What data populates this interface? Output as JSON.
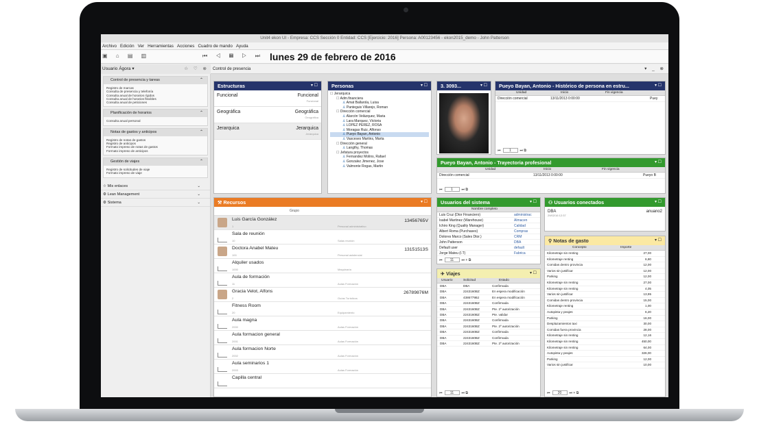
{
  "app": {
    "title": "Unit4 ekon UI - Empresa: CCS Sección 0 Entidad: CCS [Ejercicio: 2016] Persona: A00123456 - ekon2015_demo - John Patterson",
    "menu": [
      "Archivo",
      "Edición",
      "Ver",
      "Herramientas",
      "Acciones",
      "Cuadro de mando",
      "Ayuda"
    ],
    "date": "lunes 29 de febrero de 2016",
    "user": "Usuario Ágora",
    "main_title": "Control de presencia"
  },
  "sidebar": {
    "groups": [
      {
        "title": "Control de presencia y tareas",
        "items": [
          "Registro de marcas",
          "Consulta de presencia y telefonía",
          "Consulta anual de horarios rígidos",
          "Consulta anual de horarios flexibles",
          "Consulta anual de peticiones"
        ]
      },
      {
        "title": "Planificación de horarios",
        "items": [
          "Consulta anual personal"
        ]
      },
      {
        "title": "Notas de gastos y anticipos",
        "items": [
          "Registro de notas de gastos",
          "Registro de anticipos",
          "Formato impreso de notas de gastos",
          "Formato impreso de anticipos"
        ]
      },
      {
        "title": "Gestión de viajes",
        "items": [
          "Registro de solicitudes de viaje",
          "Formato impreso de viaje"
        ]
      }
    ],
    "sections": [
      "Mis enlaces",
      "Lean Management",
      "Sistema"
    ]
  },
  "estructuras": {
    "title": "Estructuras",
    "rows": [
      {
        "name": "Funcional",
        "right": "Funcional",
        "sub": "Funcional"
      },
      {
        "name": "Geográfica",
        "right": "Geográfica",
        "sub": "Geográfica"
      },
      {
        "name": "Jerarquica",
        "right": "Jerarquica",
        "sub": "Jerárquica"
      }
    ]
  },
  "personas": {
    "title": "Personas",
    "tree": [
      {
        "t": "Jerarquica",
        "lvl": 0,
        "k": "folder"
      },
      {
        "t": "Adm.financiera",
        "lvl": 1,
        "k": "folder"
      },
      {
        "t": "Amat Ballarola, Luisa",
        "lvl": 2,
        "k": "person"
      },
      {
        "t": "Panteguis Villarejo, Roman",
        "lvl": 2,
        "k": "person"
      },
      {
        "t": "Dirección comercial",
        "lvl": 1,
        "k": "folder"
      },
      {
        "t": "Alarcón Velázquez, Maria",
        "lvl": 2,
        "k": "person"
      },
      {
        "t": "Lara Marquez, Victoria",
        "lvl": 2,
        "k": "person"
      },
      {
        "t": "LOPEZ PEREZ, ROSA",
        "lvl": 2,
        "k": "person"
      },
      {
        "t": "Moragas Ruiz, Alfonso",
        "lvl": 2,
        "k": "person"
      },
      {
        "t": "Pueyo Bayan, Antonio",
        "lvl": 2,
        "k": "person",
        "sel": true
      },
      {
        "t": "Vasceses Martins, Marta",
        "lvl": 2,
        "k": "person"
      },
      {
        "t": "Dirección general",
        "lvl": 1,
        "k": "folder"
      },
      {
        "t": "Langthy, Thomas",
        "lvl": 2,
        "k": "person"
      },
      {
        "t": "Jefatura proyectos",
        "lvl": 1,
        "k": "folder"
      },
      {
        "t": "Fernandez Molins, Rafael",
        "lvl": 2,
        "k": "person"
      },
      {
        "t": "Gonzalez Jimenez, Jose",
        "lvl": 2,
        "k": "person"
      },
      {
        "t": "Valmonte Rogas, Martin",
        "lvl": 2,
        "k": "person"
      }
    ]
  },
  "photo_panel": {
    "title": "3. 3093..."
  },
  "historico": {
    "title": "Pueyo Bayan, Antonio - Histórico de persona en estru...",
    "headers": [
      "Unidad",
      "Inicio",
      "Fin vigencia"
    ],
    "rows": [
      [
        "Dirección comercial",
        "13/11/2013 0:00:00",
        "Puey"
      ]
    ],
    "page": "1"
  },
  "trayectoria": {
    "title": "Pueyo Bayan, Antonio - Trayectoria profesional",
    "headers": [
      "Unidad",
      "Inicio",
      "Fin vigencia"
    ],
    "rows": [
      [
        "Dirección comercial",
        "13/11/2013 0:00:00",
        "Pueyo B"
      ]
    ],
    "page": "1"
  },
  "recursos": {
    "title": "Recursos",
    "group_label": "Grupo",
    "rows": [
      {
        "name": "Luis García González",
        "sub": "1",
        "mid": "Personal administrativo",
        "num": "13456765V",
        "icon": "person"
      },
      {
        "name": "Sala de reunión",
        "sub": "10",
        "mid": "Salas reunión",
        "num": "",
        "icon": "room"
      },
      {
        "name": "Doctora Anabel Mateu",
        "sub": "100",
        "mid": "Personal asistencial",
        "num": "13151513S",
        "icon": "person"
      },
      {
        "name": "Alquiler usados",
        "sub": "1000",
        "mid": "Maquinaria",
        "num": "",
        "icon": "room"
      },
      {
        "name": "Aula de formación",
        "sub": "11",
        "mid": "Aulas Formación",
        "num": "",
        "icon": "room"
      },
      {
        "name": "Gracia Velot, Alfons",
        "sub": "2",
        "mid": "Guías Turísticos",
        "num": "26789876M",
        "icon": "person"
      },
      {
        "name": "Fitness Room",
        "sub": "20",
        "mid": "Equipamiento",
        "num": "",
        "icon": "room"
      },
      {
        "name": "Aula magna",
        "sub": "2000",
        "mid": "Aulas Formación",
        "num": "",
        "icon": "room"
      },
      {
        "name": "Aula formacion general",
        "sub": "2001",
        "mid": "Aulas Formación",
        "num": "",
        "icon": "room"
      },
      {
        "name": "Aula formacion Norte",
        "sub": "2002",
        "mid": "Aulas Formación",
        "num": "",
        "icon": "room"
      },
      {
        "name": "Aula seminarios 1",
        "sub": "2003",
        "mid": "Aulas Formación",
        "num": "",
        "icon": "room"
      },
      {
        "name": "Capilla central",
        "sub": "",
        "mid": "",
        "num": "",
        "icon": "room"
      }
    ]
  },
  "usuarios": {
    "title": "Usuarios del sistema",
    "header": "Nombre completo",
    "rows": [
      [
        "Luis Cruz (Dtor Financiero)",
        "administrac"
      ],
      [
        "Isabel Martinez (Warehouse)",
        "Almacen"
      ],
      [
        "Ichiro King (Quality Manager)",
        "Calidad"
      ],
      [
        "Albert Roma (Purchases)",
        "Compras"
      ],
      [
        "Dolores Marco (Sales Dtor.)",
        "CRM"
      ],
      [
        "John Patterson",
        "DBA"
      ],
      [
        "Default user",
        "default"
      ],
      [
        "Jorge Mateu (I.T)",
        "Fabrica"
      ]
    ],
    "page": "11"
  },
  "conectados": {
    "title": "Usuarios conectados",
    "row": {
      "user": "DBA",
      "date": "29/02/16 12:37",
      "right": "anuano2"
    }
  },
  "viajes": {
    "title": "Viajes",
    "headers": [
      "Usuario",
      "Solicitud",
      "Estado"
    ],
    "rows": [
      [
        "DBA",
        "DBA",
        "Confirmada"
      ],
      [
        "DBA",
        "2243160BZ",
        "En espera modificación"
      ],
      [
        "DBA",
        "4386779BJ",
        "En espera modificación"
      ],
      [
        "DBA",
        "2243160BZ",
        "Confirmada"
      ],
      [
        "DBA",
        "2243160BZ",
        "Pte. 2º autorización"
      ],
      [
        "DBA",
        "2243160BZ",
        "Pte. validar"
      ],
      [
        "DBA",
        "2243160BZ",
        "Confirmada"
      ],
      [
        "DBA",
        "2243160BZ",
        "Pte. 2º autorización"
      ],
      [
        "DBA",
        "2243160BZ",
        "Confirmada"
      ],
      [
        "DBA",
        "2243160BZ",
        "Confirmada"
      ],
      [
        "DBA",
        "2243160BZ",
        "Pte. 2º autorización"
      ]
    ],
    "page": "11"
  },
  "notas": {
    "title": "Notas de gasto",
    "headers": [
      "Concepto",
      "Importe"
    ],
    "rows": [
      [
        "Kilometraje sin renting",
        "27,00"
      ],
      [
        "Kilometraje renting",
        "6,80"
      ],
      [
        "Comidas dentro provincia",
        "12,00"
      ],
      [
        "Varios sin justificar",
        "12,00"
      ],
      [
        "Parking",
        "12,00"
      ],
      [
        "Kilometraje sin renting",
        "27,00"
      ],
      [
        "Kilometraje sin renting",
        "4,05"
      ],
      [
        "Varios sin justificar",
        "13,95"
      ],
      [
        "Comidas dentro provincia",
        "15,00"
      ],
      [
        "Kilometraje renting",
        "1,00"
      ],
      [
        "Autopista y peajes",
        "6,20"
      ],
      [
        "Parking",
        "16,00"
      ],
      [
        "Desplazamientos taxi",
        "30,00"
      ],
      [
        "Comidas fuera provincia",
        "28,00"
      ],
      [
        "Kilometraje sin renting",
        "12,16"
      ],
      [
        "Kilometraje sin renting",
        "450,00"
      ],
      [
        "Kilometraje sin renting",
        "64,00"
      ],
      [
        "Autopista y peajes",
        "326,00"
      ],
      [
        "Parking",
        "12,00"
      ],
      [
        "Varios sin justificar",
        "10,00"
      ]
    ],
    "page": "20"
  },
  "colors": {
    "navy": "#25346b",
    "green": "#339a2e",
    "orange": "#ea7b24"
  }
}
